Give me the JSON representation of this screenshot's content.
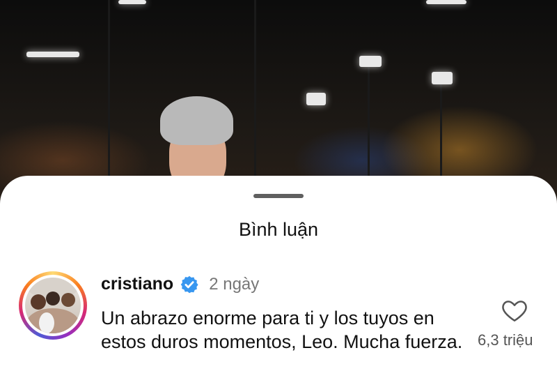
{
  "sheet": {
    "title": "Bình luận"
  },
  "comment": {
    "username": "cristiano",
    "time": "2 ngày",
    "text": "Un abrazo enorme para ti y los tuyos en estos duros momentos, Leo. Mucha fuerza.",
    "like_count": "6,3 triệu",
    "verified": true
  },
  "icons": {
    "verified": "verified-badge-icon",
    "like": "heart-outline-icon",
    "verified_color": "#3897f0"
  }
}
